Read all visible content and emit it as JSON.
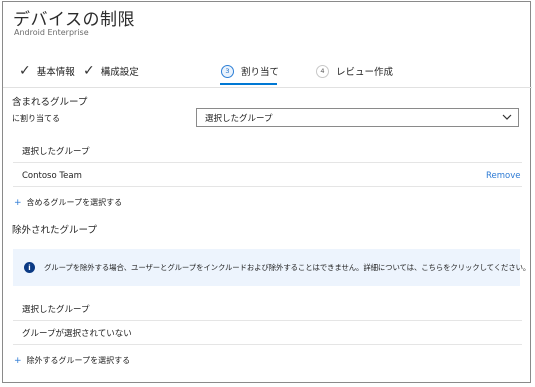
{
  "header": {
    "title": "デバイスの制限",
    "subtitle": "Android Enterprise"
  },
  "steps": [
    {
      "label": "基本情報",
      "state": "done"
    },
    {
      "label": "構成設定",
      "state": "done"
    },
    {
      "number": "3",
      "label": "割り当て",
      "state": "active"
    },
    {
      "number": "4",
      "label": "レビュー作成",
      "state": "pending"
    }
  ],
  "included": {
    "section_title": "含まれるグループ",
    "assign_label": "に割り当てる",
    "dropdown_value": "選択したグループ",
    "selected_groups_label": "選択したグループ",
    "group_name": "Contoso Team",
    "remove_label": "Remove",
    "add_link": "含めるグループを選択する"
  },
  "excluded": {
    "section_title": "除外されたグループ",
    "info_text": "グループを除外する場合、ユーザーとグループをインクルードおよび除外することはできません。詳細については、こちらをクリックしてください。",
    "selected_groups_label": "選択したグループ",
    "empty_text": "グループが選択されていない",
    "add_link": "除外するグループを選択する"
  },
  "colors": {
    "accent": "#0078d4",
    "link": "#2c7ad4",
    "info_bg": "#edf4fd",
    "info_icon": "#0b3a84"
  }
}
